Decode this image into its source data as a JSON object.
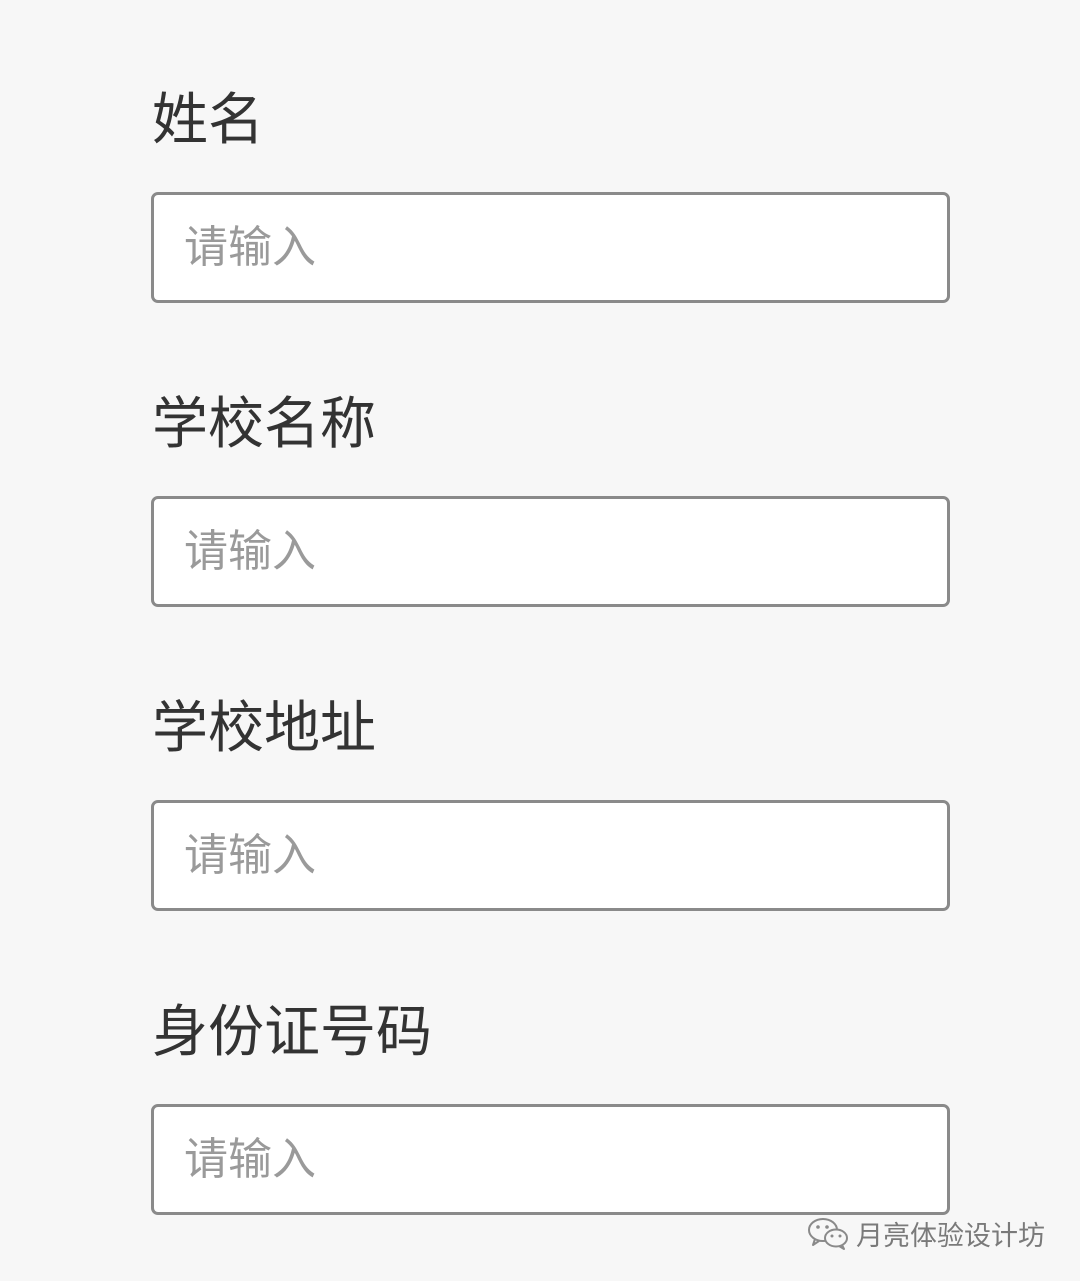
{
  "form": {
    "fields": [
      {
        "label": "姓名",
        "value": "",
        "placeholder": "请输入"
      },
      {
        "label": "学校名称",
        "value": "",
        "placeholder": "请输入"
      },
      {
        "label": "学校地址",
        "value": "",
        "placeholder": "请输入"
      },
      {
        "label": "身份证号码",
        "value": "",
        "placeholder": "请输入"
      }
    ]
  },
  "watermark": {
    "icon": "wechat-icon",
    "text": "月亮体验设计坊"
  },
  "colors": {
    "background": "#f7f7f7",
    "label_text": "#333333",
    "input_border": "#8a8a8a",
    "placeholder": "#9a9a9a"
  }
}
